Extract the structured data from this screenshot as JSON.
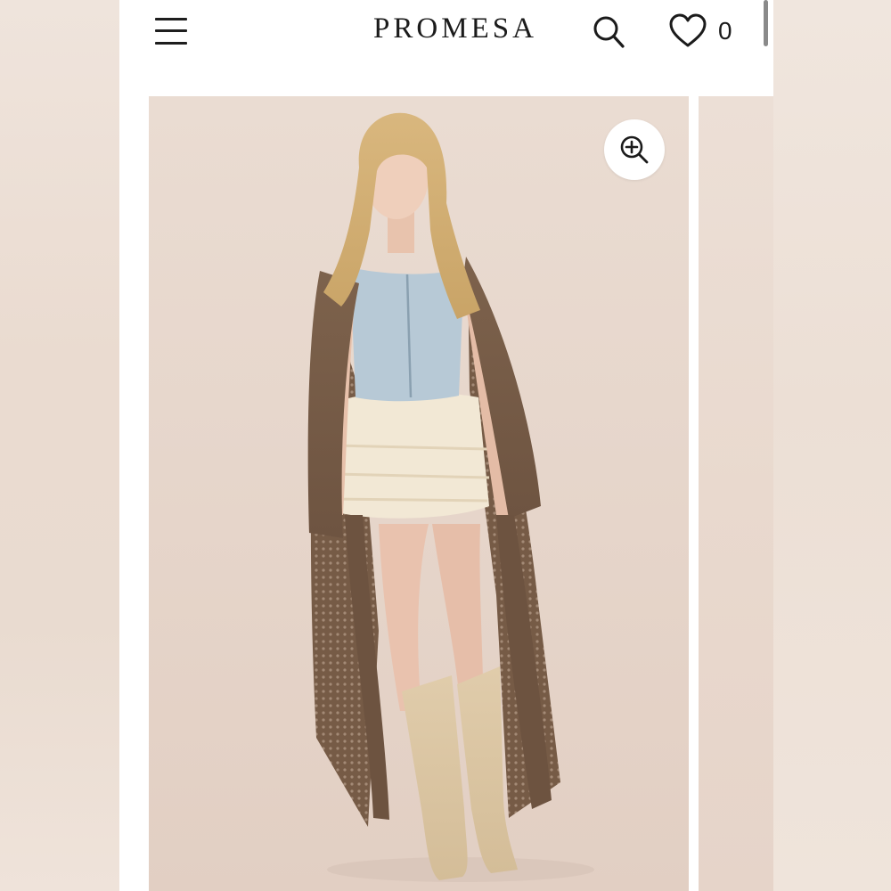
{
  "header": {
    "brand": "PROMESA",
    "wishlist_count": "0",
    "icons": {
      "menu": "hamburger-menu-icon",
      "search": "search-icon",
      "wishlist": "heart-icon"
    }
  },
  "gallery": {
    "image": "product-photo",
    "zoom_icon": "zoom-in-icon"
  },
  "colors": {
    "text": "#1b1b1b",
    "background": "#ffffff",
    "photo_backdrop": "#e8d8cd",
    "cardigan": "#7a5f48",
    "top": "#b9cad6",
    "shorts": "#f1e7d3",
    "boots": "#dcc7a4"
  }
}
